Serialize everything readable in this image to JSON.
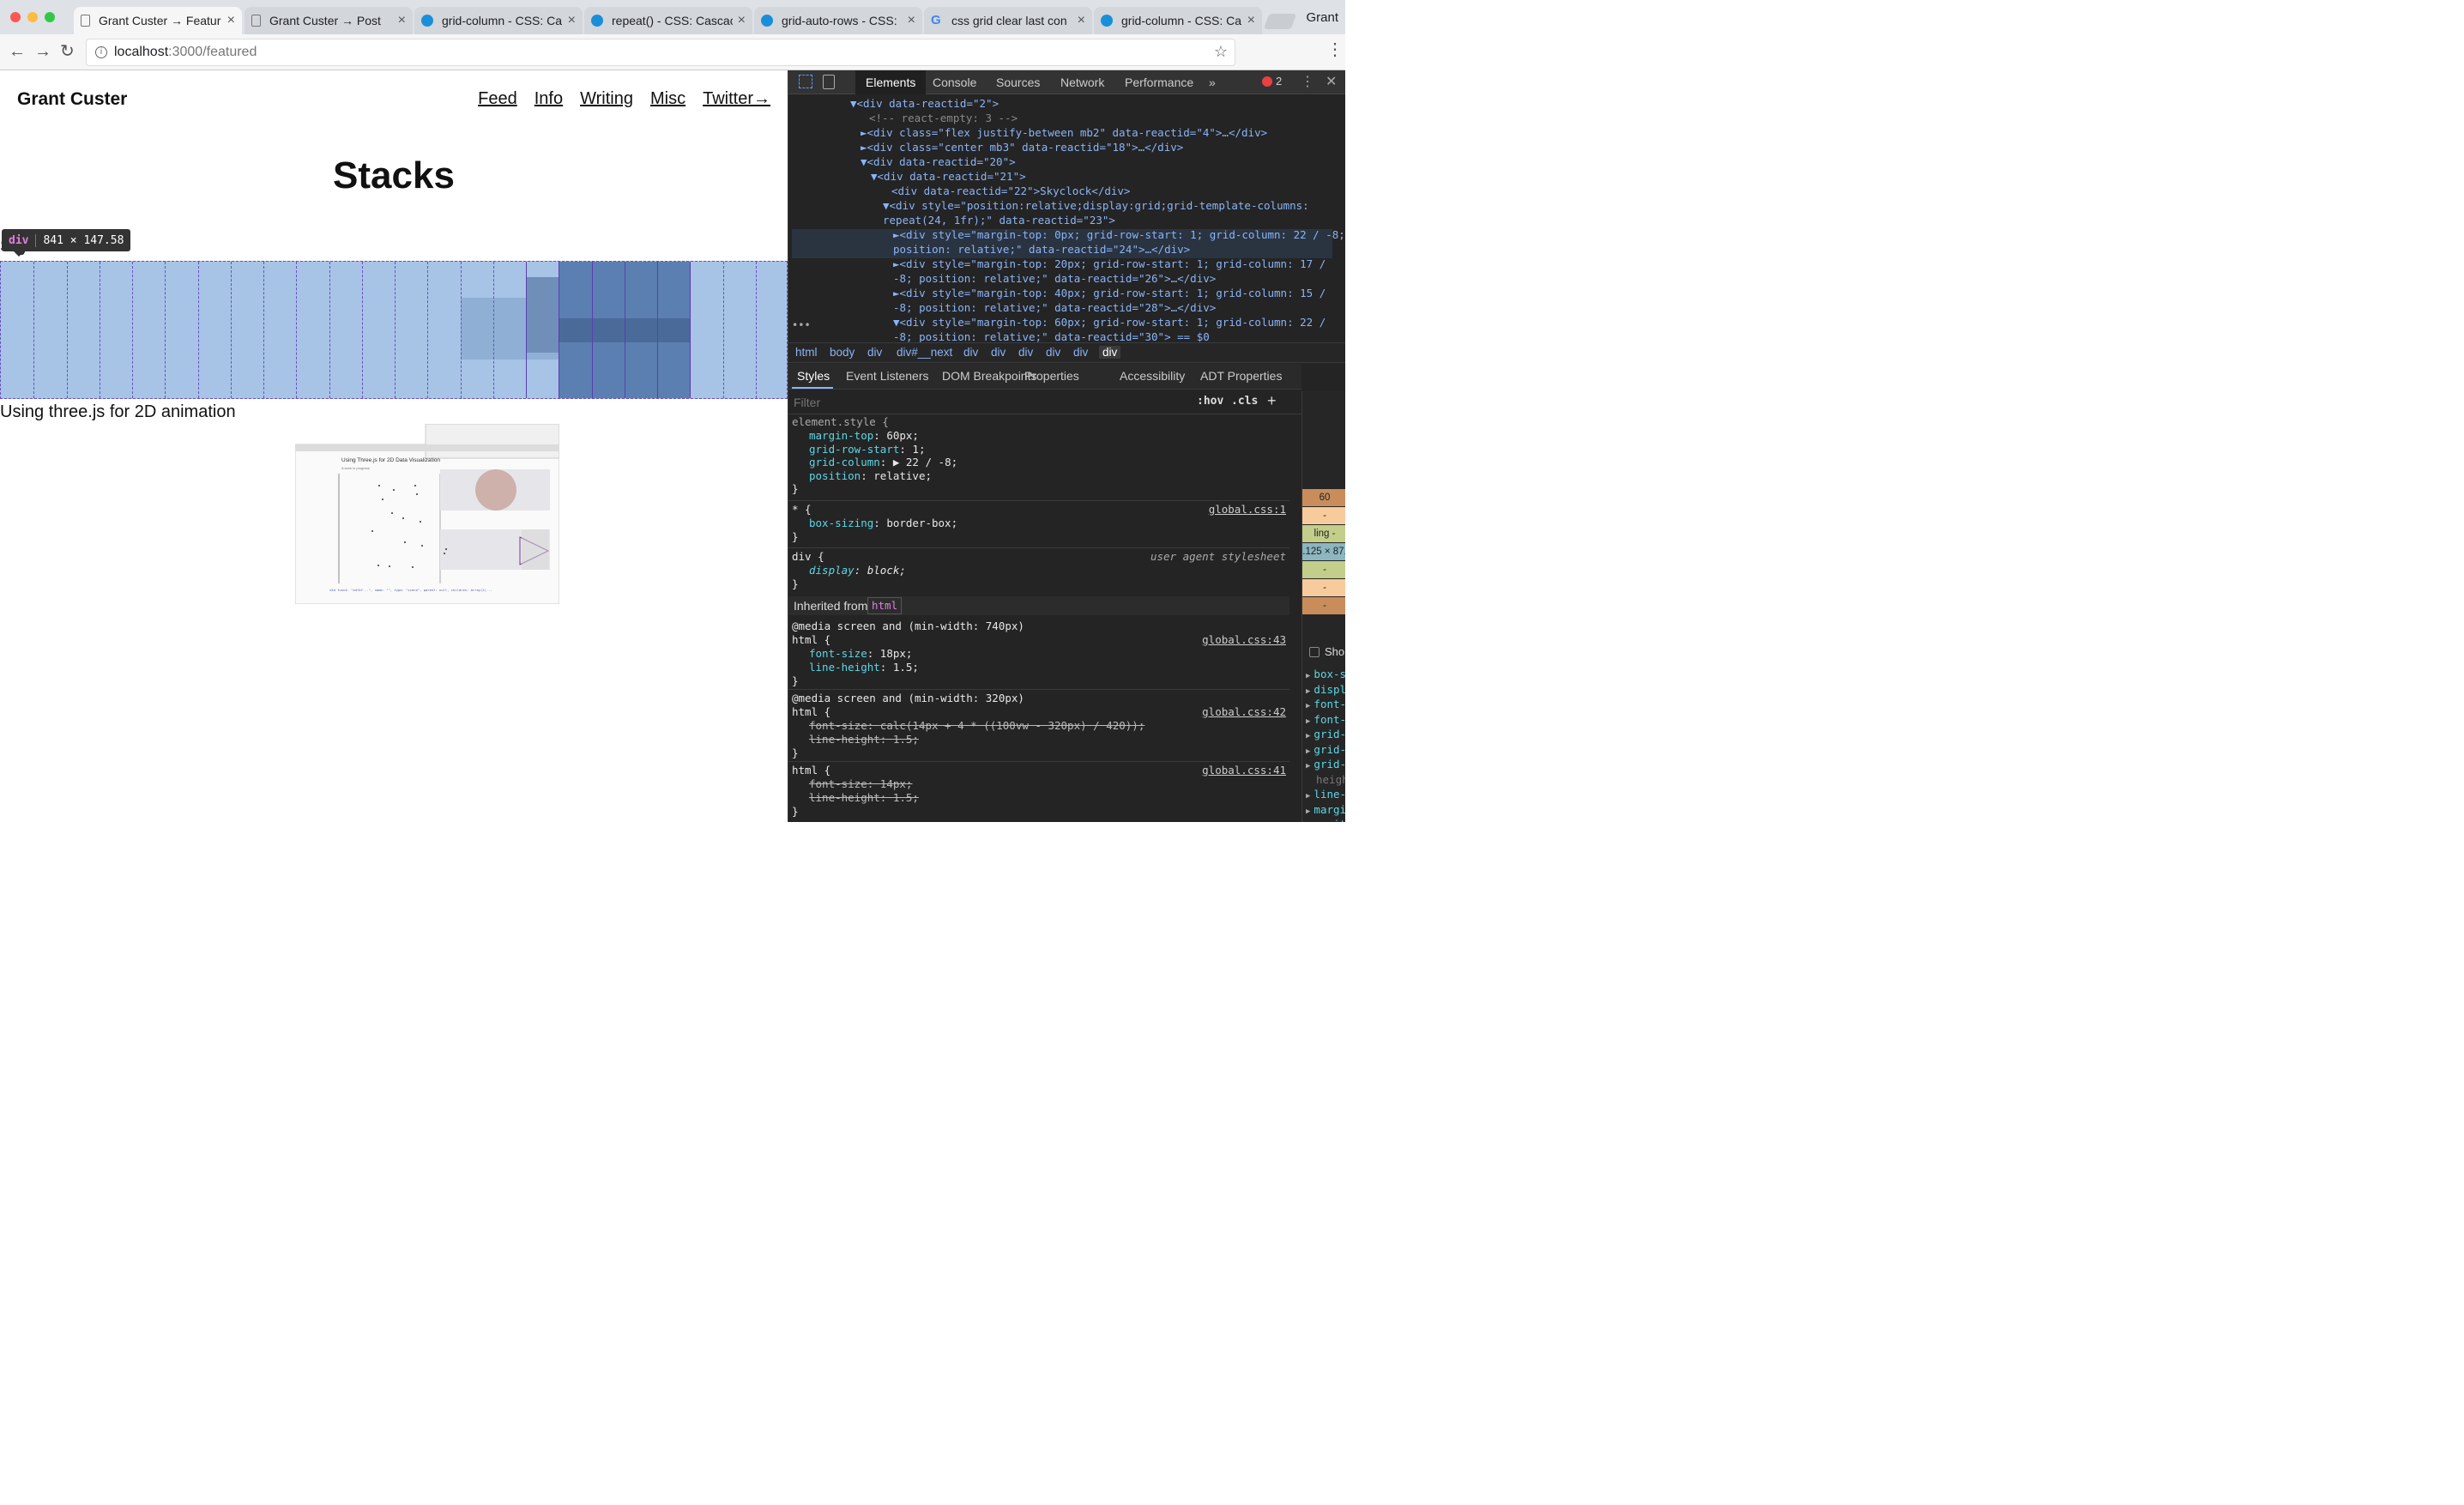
{
  "browser": {
    "tabs": [
      {
        "title": "Grant Custer → Featur",
        "icon": "page-icon",
        "active": true
      },
      {
        "title": "Grant Custer → Post",
        "icon": "page-icon"
      },
      {
        "title": "grid-column - CSS: Ca",
        "icon": "mdn-icon"
      },
      {
        "title": "repeat() - CSS: Cascac",
        "icon": "mdn-icon"
      },
      {
        "title": "grid-auto-rows - CSS:",
        "icon": "mdn-icon"
      },
      {
        "title": "css grid clear last con",
        "icon": "google-icon"
      },
      {
        "title": "grid-column - CSS: Ca",
        "icon": "mdn-icon"
      }
    ],
    "profile": "Grant",
    "url_host": "localhost",
    "url_path": ":3000/featured"
  },
  "page": {
    "brand": "Grant Custer",
    "nav": [
      "Feed",
      "Info",
      "Writing",
      "Misc",
      "Twitter→"
    ],
    "heading": "Stacks",
    "item1_title": "Skyclock",
    "item2_title": "Using three.js for 2D animation",
    "tooltip_tag": "div",
    "tooltip_size": "841 × 147.58",
    "thumb_title": "Using Three.js for 2D Data Visualization",
    "thumb_sub": "A work in progress",
    "thumb_code": "v4d func4: \"a4f4f...\", name: \"\", type: \"scene\", parent: null, children: Array(2)..."
  },
  "devtools": {
    "tabs": [
      "Elements",
      "Console",
      "Sources",
      "Network",
      "Performance",
      "»"
    ],
    "error_count": "2",
    "dom": [
      {
        "t": "▼<div data-reactid=\"2\">"
      },
      {
        "t": "<!-- react-empty: 3 -->"
      },
      {
        "t": "►<div class=\"flex justify-between mb2\" data-reactid=\"4\">…</div>"
      },
      {
        "t": "►<div class=\"center mb3\" data-reactid=\"18\">…</div>"
      },
      {
        "t": "▼<div data-reactid=\"20\">"
      },
      {
        "t": "▼<div data-reactid=\"21\">"
      },
      {
        "t": "<div data-reactid=\"22\">Skyclock</div>"
      },
      {
        "t": "▼<div style=\"position:relative;display:grid;grid-template-columns:"
      },
      {
        "t": "repeat(24, 1fr);\" data-reactid=\"23\">"
      },
      {
        "t": "►<div style=\"margin-top: 0px; grid-row-start: 1; grid-column: 22 / -8;"
      },
      {
        "t": "position: relative;\" data-reactid=\"24\">…</div>"
      },
      {
        "t": "►<div style=\"margin-top: 20px; grid-row-start: 1; grid-column: 17 /"
      },
      {
        "t": "-8; position: relative;\" data-reactid=\"26\">…</div>"
      },
      {
        "t": "►<div style=\"margin-top: 40px; grid-row-start: 1; grid-column: 15 /"
      },
      {
        "t": "-8; position: relative;\" data-reactid=\"28\">…</div>"
      },
      {
        "t": "▼<div style=\"margin-top: 60px; grid-row-start: 1; grid-column: 22 /"
      },
      {
        "t": "-8; position: relative;\" data-reactid=\"30\"> == $0"
      }
    ],
    "crumbs": [
      "html",
      "body",
      "div",
      "div#__next",
      "div",
      "div",
      "div",
      "div",
      "div",
      "div"
    ],
    "styles_tabs": [
      "Styles",
      "Event Listeners",
      "DOM Breakpoints",
      "Properties",
      "Accessibility",
      "ADT Properties"
    ],
    "filter_placeholder": "Filter",
    "hov": ":hov",
    "cls": ".cls",
    "rules": {
      "element_style": "element.style {",
      "es_props": [
        {
          "p": "margin-top",
          "v": "60px;"
        },
        {
          "p": "grid-row-start",
          "v": "1;"
        },
        {
          "p": "grid-column",
          "v": "▶ 22 / -8;"
        },
        {
          "p": "position",
          "v": "relative;"
        }
      ],
      "star_sel": "* {",
      "star_prop": {
        "p": "box-sizing",
        "v": "border-box;"
      },
      "star_src": "global.css:1",
      "div_sel": "div {",
      "div_prop": {
        "p": "display",
        "v": "block;"
      },
      "div_src": "user agent stylesheet",
      "inherited": "Inherited from",
      "inherited_tag": "html",
      "media1": "@media screen and (min-width: 740px)",
      "media1_sel": "html {",
      "media1_src": "global.css:43",
      "media1_props": [
        {
          "p": "font-size",
          "v": "18px;"
        },
        {
          "p": "line-height",
          "v": "1.5;"
        }
      ],
      "media2": "@media screen and (min-width: 320px)",
      "media2_sel": "html {",
      "media2_src": "global.css:42",
      "media2_props": [
        {
          "p": "font-size",
          "v": "calc(14px + 4 * ((100vw - 320px) / 420));"
        },
        {
          "p": "line-height",
          "v": "1.5;"
        }
      ],
      "html_sel": "html {",
      "html_src": "global.css:41",
      "html_props": [
        {
          "p": "font-size",
          "v": "14px;"
        },
        {
          "p": "line-height",
          "v": "1.5;"
        }
      ],
      "close": "}"
    },
    "boxmodel": [
      "60",
      "-",
      "ling  -",
      ".125 × 87.",
      "-",
      "-",
      "-"
    ],
    "show_all": "Sho",
    "computed": [
      "box-s",
      "displ",
      "font-",
      "font-",
      "grid-",
      "grid-",
      "grid-",
      "heigh",
      "line-",
      "margi",
      "posit",
      "width"
    ]
  },
  "colors": {
    "highlight": "#a7c4e6",
    "grid_line": "#6a4ec0",
    "devtools_bg": "#242424",
    "prop": "#5dd6e6"
  }
}
